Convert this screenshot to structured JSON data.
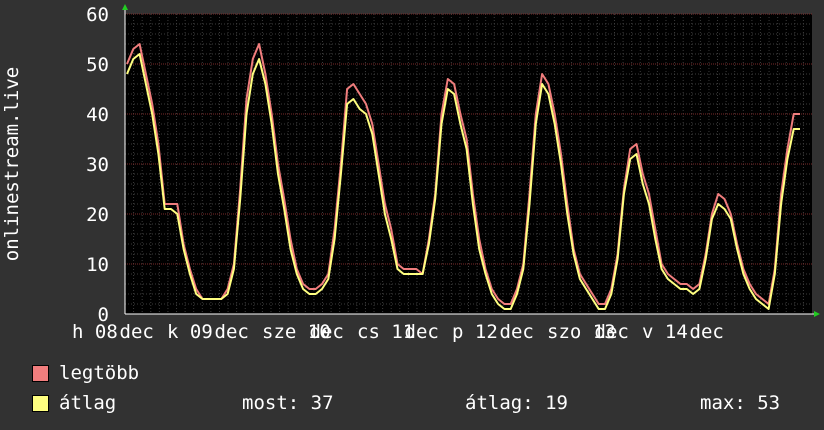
{
  "chart_data": {
    "type": "line",
    "ylabel": "onlinestream.live",
    "ylim": [
      0,
      60
    ],
    "yticks": [
      "0",
      "10",
      "20",
      "30",
      "40",
      "50",
      "60"
    ],
    "xticks": [
      "h 08",
      "dec",
      "k 09",
      "dec",
      "sze 10",
      "dec",
      "cs 11",
      "dec",
      "p 12",
      "dec",
      "szo 13",
      "dec",
      "v 14",
      "dec"
    ],
    "grid": true,
    "series": [
      {
        "name": "legtöbb",
        "color": "#f07d7d",
        "values": [
          50,
          53,
          54,
          48,
          42,
          34,
          22,
          22,
          22,
          14,
          9,
          5,
          3,
          3,
          3,
          3,
          5,
          10,
          25,
          43,
          51,
          54,
          48,
          40,
          30,
          23,
          15,
          9,
          6,
          5,
          5,
          6,
          8,
          17,
          30,
          45,
          46,
          44,
          42,
          38,
          30,
          22,
          17,
          10,
          9,
          9,
          9,
          8,
          15,
          24,
          40,
          47,
          46,
          40,
          35,
          24,
          15,
          9,
          5,
          3,
          2,
          2,
          5,
          10,
          24,
          40,
          48,
          46,
          40,
          32,
          22,
          13,
          8,
          6,
          4,
          2,
          2,
          5,
          12,
          25,
          33,
          34,
          28,
          24,
          17,
          10,
          8,
          7,
          6,
          6,
          5,
          6,
          12,
          20,
          24,
          23,
          20,
          14,
          9,
          6,
          4,
          3,
          2,
          9,
          24,
          33,
          40,
          40
        ]
      },
      {
        "name": "átlag",
        "color": "#ffff80",
        "values": [
          48,
          51,
          52,
          46,
          40,
          32,
          21,
          21,
          20,
          13,
          8,
          4,
          3,
          3,
          3,
          3,
          4,
          9,
          23,
          40,
          48,
          51,
          46,
          38,
          28,
          21,
          13,
          8,
          5,
          4,
          4,
          5,
          7,
          15,
          28,
          42,
          43,
          41,
          40,
          36,
          28,
          20,
          15,
          9,
          8,
          8,
          8,
          8,
          14,
          23,
          38,
          45,
          44,
          38,
          33,
          22,
          13,
          8,
          4,
          2,
          1,
          1,
          4,
          9,
          22,
          38,
          46,
          44,
          38,
          30,
          20,
          12,
          7,
          5,
          3,
          1,
          1,
          4,
          11,
          24,
          31,
          32,
          26,
          22,
          15,
          9,
          7,
          6,
          5,
          5,
          4,
          5,
          11,
          19,
          22,
          21,
          19,
          13,
          8,
          5,
          3,
          2,
          1,
          8,
          22,
          31,
          37,
          37
        ]
      }
    ]
  },
  "legend": {
    "max_label": "legtöbb",
    "avg_label": "átlag",
    "now_text": "most: 37",
    "avg_text": "átlag: 19",
    "maxval_text": "max: 53"
  }
}
